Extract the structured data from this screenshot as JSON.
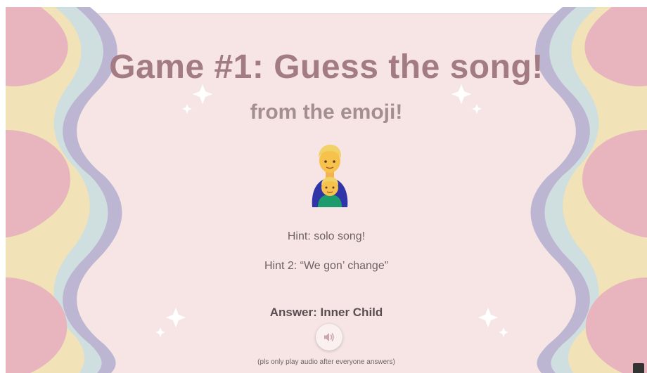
{
  "slide": {
    "title": "Game #1: Guess the song!",
    "subtitle": "from the emoji!",
    "emoji_icon": "man-and-boy-emoji",
    "hint1": "Hint: solo song!",
    "hint2": "Hint 2: “We gon’ change”",
    "answer": "Answer: Inner Child",
    "audio_button_icon": "speaker-icon",
    "audio_note": "(pls only play audio after everyone answers)"
  },
  "colors": {
    "background": "#f6e5e4",
    "title": "#a27b83",
    "subtitle": "#a58e90",
    "wave_pink": "#e8b4bd",
    "wave_yellow": "#f1e2b8",
    "wave_blue": "#cfdfe0",
    "wave_lavender": "#bdb6d3"
  }
}
